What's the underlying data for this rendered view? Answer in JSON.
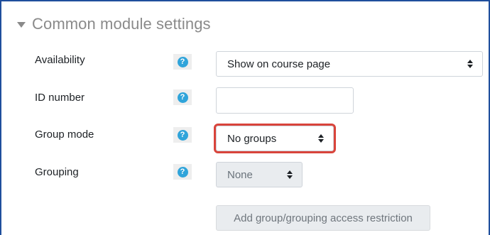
{
  "section": {
    "title": "Common module settings",
    "collapse_icon": "caret-down-icon"
  },
  "fields": {
    "availability": {
      "label": "Availability",
      "help_icon": "question-circle-icon",
      "help_glyph": "?",
      "value": "Show on course page"
    },
    "id_number": {
      "label": "ID number",
      "help_icon": "question-circle-icon",
      "help_glyph": "?",
      "value": ""
    },
    "group_mode": {
      "label": "Group mode",
      "help_icon": "question-circle-icon",
      "help_glyph": "?",
      "value": "No groups"
    },
    "grouping": {
      "label": "Grouping",
      "help_icon": "question-circle-icon",
      "help_glyph": "?",
      "value": "None"
    }
  },
  "actions": {
    "add_restriction_label": "Add group/grouping access restriction"
  },
  "colors": {
    "frame_border": "#1f4e9c",
    "help_icon": "#30a4da",
    "highlight": "#d9443b"
  }
}
